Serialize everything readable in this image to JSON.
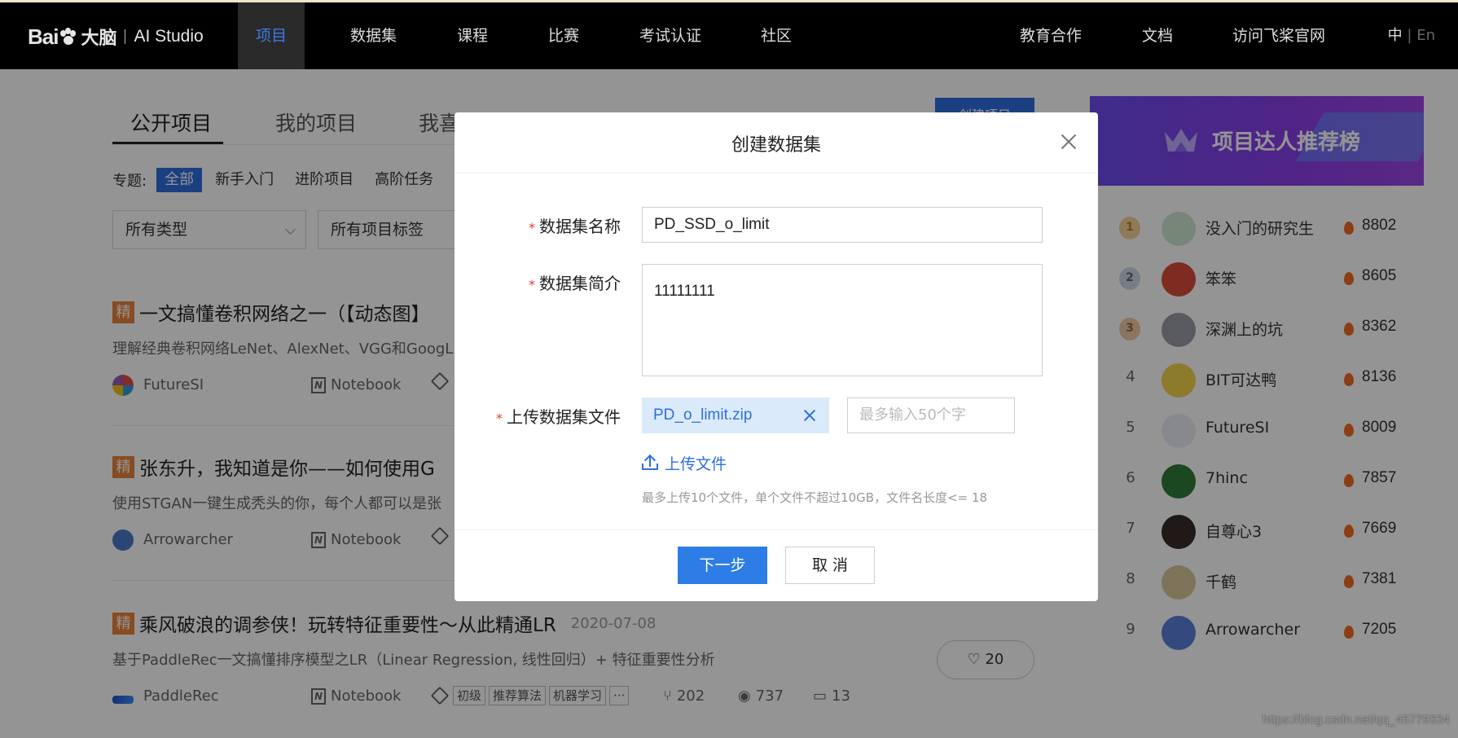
{
  "nav": {
    "logo_bai": "Bai",
    "logo_du": "大脑",
    "logo_product": "AI Studio",
    "items": [
      "项目",
      "数据集",
      "课程",
      "比赛",
      "考试认证",
      "社区"
    ],
    "right_items": [
      "教育合作",
      "文档",
      "访问飞桨官网"
    ],
    "lang_zh": "中",
    "lang_sep": "|",
    "lang_en": "En"
  },
  "tabs": [
    "公开项目",
    "我的项目",
    "我喜欢的"
  ],
  "create_project": "创建项目",
  "topics": {
    "label": "专题:",
    "chips": [
      "全部",
      "新手入门",
      "进阶项目",
      "高阶任务"
    ]
  },
  "filters": {
    "type": "所有类型",
    "tags": "所有项目标签"
  },
  "projects": [
    {
      "badge": "精",
      "title": "一文搞懂卷积网络之一（【动态图】",
      "desc": "理解经典卷积网络LeNet、AlexNet、VGG和GoogL",
      "author": "FutureSI",
      "kind": "Notebook"
    },
    {
      "badge": "精",
      "title": "张东升，我知道是你——如何使用G",
      "desc": "使用STGAN一键生成秃头的你，每个人都可以是张",
      "author": "Arrowarcher",
      "kind": "Notebook"
    },
    {
      "badge": "精",
      "title": "乘风破浪的调参侠！玩转特征重要性～从此精通LR",
      "date": "2020-07-08",
      "desc": "基于PaddleRec一文搞懂排序模型之LR（Linear Regression, 线性回归）+ 特征重要性分析",
      "author": "PaddleRec",
      "kind": "Notebook",
      "tags": [
        "初级",
        "推荐算法",
        "机器学习",
        "···"
      ],
      "forks": "202",
      "views": "737",
      "comments": "13",
      "likes": "20"
    }
  ],
  "ranking": {
    "title": "项目达人推荐榜",
    "rows": [
      {
        "rank": "1",
        "name": "没入门的研究生",
        "score": "8802"
      },
      {
        "rank": "2",
        "name": "笨笨",
        "score": "8605"
      },
      {
        "rank": "3",
        "name": "深渊上的坑",
        "score": "8362"
      },
      {
        "rank": "4",
        "name": "BIT可达鸭",
        "score": "8136"
      },
      {
        "rank": "5",
        "name": "FutureSI",
        "score": "8009"
      },
      {
        "rank": "6",
        "name": "7hinc",
        "score": "7857"
      },
      {
        "rank": "7",
        "name": "自尊心3",
        "score": "7669"
      },
      {
        "rank": "8",
        "name": "千鹤",
        "score": "7381"
      },
      {
        "rank": "9",
        "name": "Arrowarcher",
        "score": "7205"
      }
    ]
  },
  "modal": {
    "title": "创建数据集",
    "name_label": "数据集名称",
    "name_value": "PD_SSD_o_limit",
    "desc_label": "数据集简介",
    "desc_value": "11111111",
    "file_label": "上传数据集文件",
    "file_name": "PD_o_limit.zip",
    "file_note_placeholder": "最多输入50个字",
    "upload_link": "上传文件",
    "hint": "最多上传10个文件，单个文件不超过10GB，文件名长度<= 18",
    "next_button": "下一步",
    "cancel_button": "取 消",
    "required_mark": "*"
  },
  "watermark": "https://blog.csdn.net/qq_45779334",
  "colors": {
    "accent": "#2e6fde",
    "badge": "#e8833a",
    "required": "#e53935"
  }
}
